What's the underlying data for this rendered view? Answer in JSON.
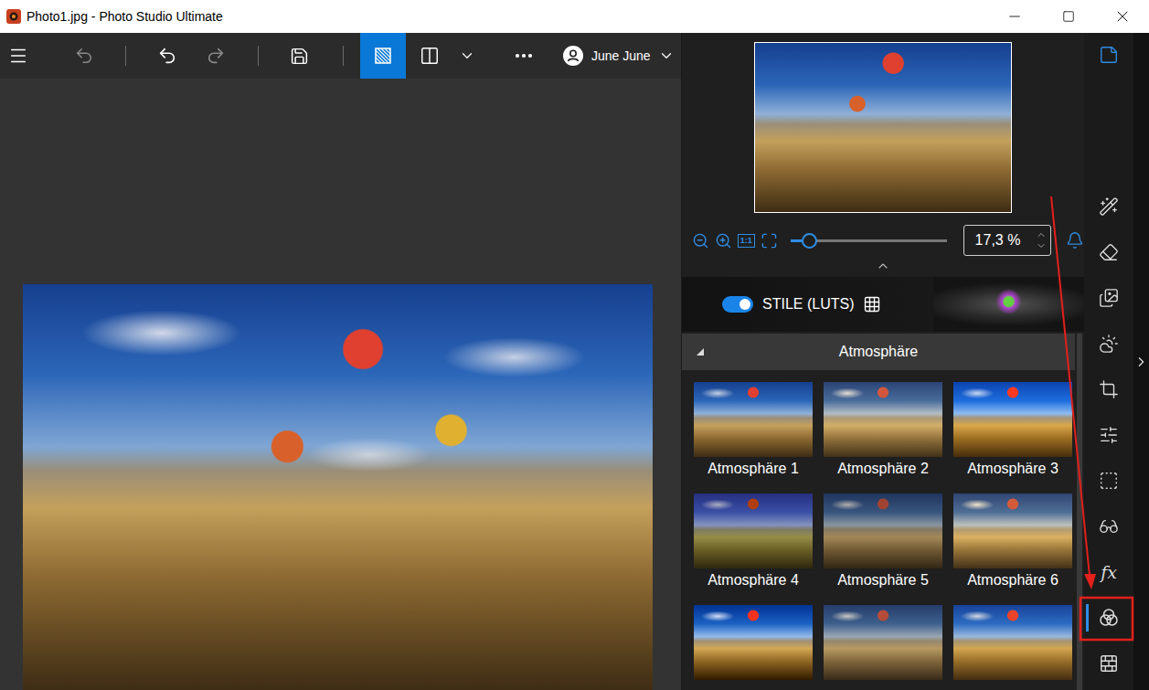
{
  "window": {
    "title": "Photo1.jpg - Photo Studio Ultimate"
  },
  "toolbar": {
    "buttons": [
      {
        "kind": "menu",
        "disabled": false,
        "selected": false
      },
      {
        "kind": "undo_all",
        "disabled": true,
        "selected": false
      },
      {
        "kind": "undo",
        "disabled": false,
        "selected": false
      },
      {
        "kind": "redo",
        "disabled": true,
        "selected": false
      },
      {
        "kind": "save",
        "disabled": false,
        "selected": false
      },
      {
        "kind": "compare",
        "disabled": false,
        "selected": true
      },
      {
        "kind": "split",
        "disabled": false,
        "selected": false
      },
      {
        "kind": "split_menu",
        "disabled": false,
        "selected": false
      },
      {
        "kind": "more",
        "disabled": false,
        "selected": false
      }
    ],
    "user": {
      "name": "June June"
    }
  },
  "preview": {
    "zoom": "17,3 %",
    "zoom_level": 0.12,
    "one_to_one": "1:1"
  },
  "styles": {
    "label": "STILE (LUTS)",
    "on": true
  },
  "section": {
    "title": "Atmosphäre",
    "expanded": true
  },
  "presets": [
    {
      "label": "Atmosphäre 1"
    },
    {
      "label": "Atmosphäre 2"
    },
    {
      "label": "Atmosphäre 3"
    },
    {
      "label": "Atmosphäre 4"
    },
    {
      "label": "Atmosphäre 5"
    },
    {
      "label": "Atmosphäre 6"
    },
    {
      "label": ""
    },
    {
      "label": ""
    },
    {
      "label": ""
    }
  ],
  "tools": [
    {
      "kind": "notes",
      "selected": false,
      "highlighted": true,
      "label": ""
    },
    {
      "kind": "text_ai",
      "selected": false,
      "highlighted": false,
      "label": ""
    },
    {
      "kind": "eraser",
      "selected": false,
      "highlighted": false,
      "label": ""
    },
    {
      "kind": "portrait",
      "selected": false,
      "highlighted": false,
      "label": ""
    },
    {
      "kind": "weather",
      "selected": false,
      "highlighted": false,
      "label": ""
    },
    {
      "kind": "crop",
      "selected": false,
      "highlighted": false,
      "label": ""
    },
    {
      "kind": "adjust",
      "selected": false,
      "highlighted": false,
      "label": ""
    },
    {
      "kind": "selection",
      "selected": false,
      "highlighted": false,
      "label": ""
    },
    {
      "kind": "glasses",
      "selected": false,
      "highlighted": false,
      "label": ""
    },
    {
      "kind": "fx",
      "selected": false,
      "highlighted": false,
      "label": "fx"
    },
    {
      "kind": "luts",
      "selected": true,
      "highlighted": false,
      "label": ""
    },
    {
      "kind": "texture",
      "selected": false,
      "highlighted": false,
      "label": ""
    }
  ]
}
